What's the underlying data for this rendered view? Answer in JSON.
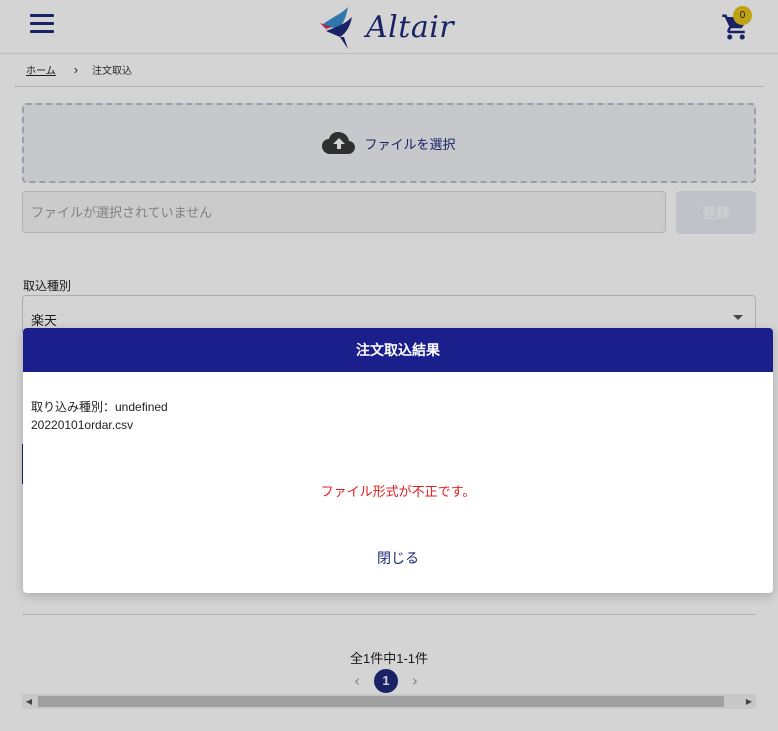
{
  "header": {
    "logo_text": "Altair",
    "cart_count": "0"
  },
  "breadcrumb": {
    "home": "ホーム",
    "current": "注文取込"
  },
  "upload": {
    "dropzone_label": "ファイルを選択",
    "file_placeholder": "ファイルが選択されていません",
    "register_label": "登録"
  },
  "import_type": {
    "label": "取込種別",
    "selected": "楽天"
  },
  "pagination": {
    "summary": "全1件中1-1件",
    "current_page": "1"
  },
  "modal": {
    "title": "注文取込結果",
    "type_line": "取り込み種別：undefined",
    "file_name": "20220101ordar.csv",
    "error_message": "ファイル形式が不正です。",
    "close_label": "閉じる"
  },
  "colors": {
    "brand_navy": "#1b1f8c",
    "error_red": "#e02020",
    "badge_yellow": "#e6c218"
  }
}
